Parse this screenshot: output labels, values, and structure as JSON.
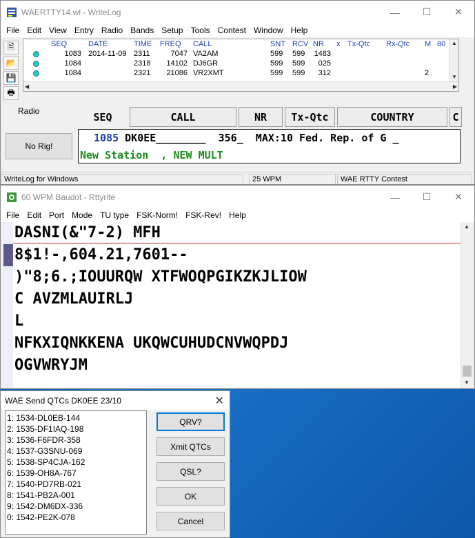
{
  "writelog": {
    "title": "WAERTTY14.wl - WriteLog",
    "menu": [
      "File",
      "Edit",
      "View",
      "Entry",
      "Radio",
      "Bands",
      "Setup",
      "Tools",
      "Contest",
      "Window",
      "Help"
    ],
    "columns": [
      "SEQ",
      "DATE",
      "TIME",
      "FREQ",
      "CALL",
      "SNT",
      "RCV",
      "NR",
      "x",
      "Tx-Qtc",
      "Rx-Qtc",
      "M",
      "80"
    ],
    "rows": [
      {
        "seq": "1083",
        "date": "2014-11-09",
        "time": "2311",
        "freq": "7047",
        "call": "VA2AM",
        "snt": "599",
        "rcv": "599",
        "nr": "1483",
        "m": ""
      },
      {
        "seq": "1084",
        "date": "",
        "time": "2318",
        "freq": "14102",
        "call": "DJ6GR",
        "snt": "599",
        "rcv": "599",
        "nr": "025",
        "m": ""
      },
      {
        "seq": "1084",
        "date": "",
        "time": "2321",
        "freq": "21086",
        "call": "VR2XMT",
        "snt": "599",
        "rcv": "599",
        "nr": "312",
        "m": "2"
      }
    ],
    "radio_label": "Radio",
    "no_rig_button": "No Rig!",
    "entry_headers": [
      "SEQ",
      "CALL",
      "NR",
      "Tx-Qtc",
      "COUNTRY",
      "C"
    ],
    "entry_seq": "1085",
    "entry_line1_rest": " DK0EE________  356_  MAX:10 Fed. Rep. of G _",
    "entry_line2": "New Station  , NEW MULT",
    "status": [
      "WriteLog for Windows",
      "",
      "25 WPM",
      "WAE RTTY Contest"
    ]
  },
  "rttyrite": {
    "title": "60 WPM Baudot - Rttyrite",
    "menu": [
      "File",
      "Edit",
      "Port",
      "Mode",
      "TU type",
      "FSK-Norm!",
      "FSK-Rev!",
      "Help"
    ],
    "lines": [
      "DASNI(&\"7-2) MFH",
      "8$1!-,604.21,7601--",
      ")\"8;6.;IOUURQW XTFWOQPGIKZKJLIOW",
      "C AVZMLAUIRLJ",
      "L",
      "NFKXIQNKKENA UKQWCUHUDCNVWQPDJ",
      "OGVWRYJM"
    ]
  },
  "qtc_dialog": {
    "title": "WAE Send QTCs DK0EE 23/10",
    "items": [
      "1: 1534-DL0EB-144",
      "2: 1535-DF1IAQ-198",
      "3: 1536-F6FDR-358",
      "4: 1537-G3SNU-069",
      "5: 1538-SP4CJA-162",
      "6: 1539-OH8A-767",
      "7: 1540-PD7RB-021",
      "8: 1541-PB2A-001",
      "9: 1542-DM6DX-336",
      "0: 1542-PE2K-078"
    ],
    "buttons": [
      "QRV?",
      "Xmit QTCs",
      "QSL?",
      "OK",
      "Cancel"
    ]
  },
  "colors": {
    "desktop": "#0a5fb8",
    "seq_blue": "#1a3fae",
    "new_station_green": "#1a8a1a",
    "qso_dot": "#30c8c8"
  }
}
